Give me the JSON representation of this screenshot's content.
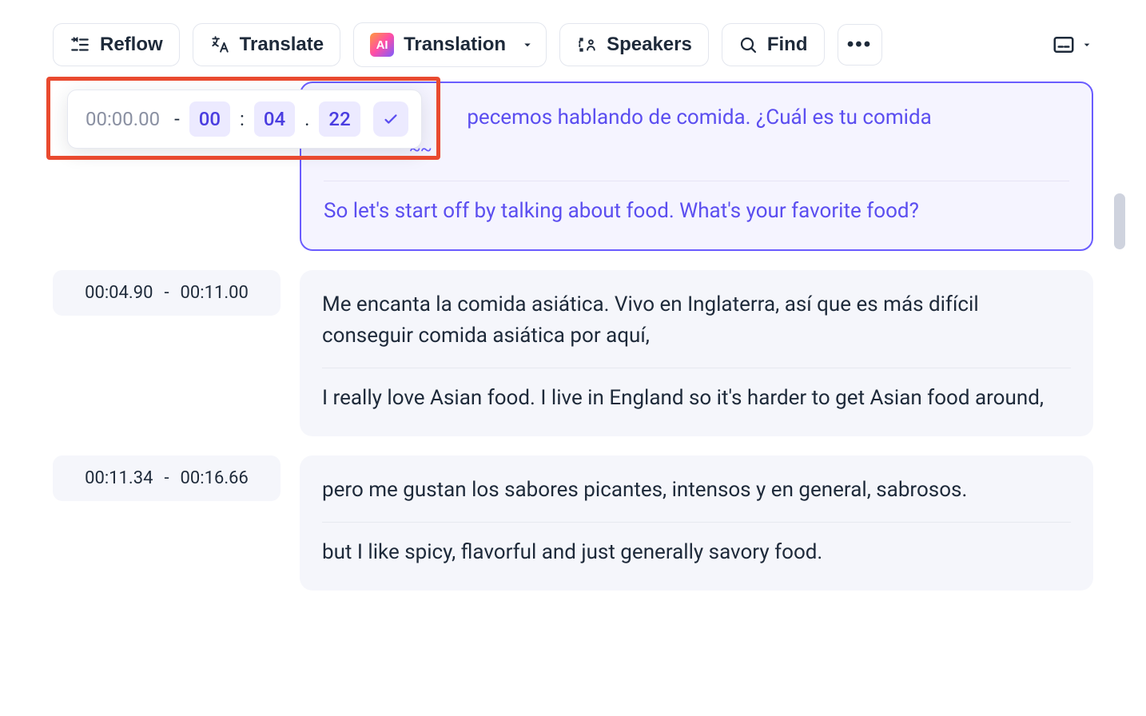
{
  "toolbar": {
    "reflow_label": "Reflow",
    "translate_label": "Translate",
    "translation_label": "Translation",
    "speakers_label": "Speakers",
    "find_label": "Find",
    "ai_badge_text": "AI"
  },
  "time_editor": {
    "start": "00:00.00",
    "dash": "-",
    "mm": "00",
    "colon": ":",
    "ss": "04",
    "dot": ".",
    "cs": "22"
  },
  "segments": [
    {
      "start": "00:00.00",
      "end": "00:04.22",
      "selected": true,
      "source_prefix": "pecemos hablando de comida. ¿Cuál es tu comida",
      "source_tail": "",
      "cursor": "~~",
      "translation": "So let's start off by talking about food. What's your favorite food?"
    },
    {
      "start": "00:04.90",
      "end": "00:11.00",
      "selected": false,
      "source": "Me encanta la comida asiática. Vivo en Inglaterra, así que es más difícil conseguir comida asiática por aquí,",
      "translation": "I really love Asian food. I live in England so it's harder to get Asian food around,"
    },
    {
      "start": "00:11.34",
      "end": "00:16.66",
      "selected": false,
      "source": "pero me gustan los sabores picantes, intensos y en general, sabrosos.",
      "translation": "but I like spicy, flavorful and just generally savory food."
    }
  ]
}
